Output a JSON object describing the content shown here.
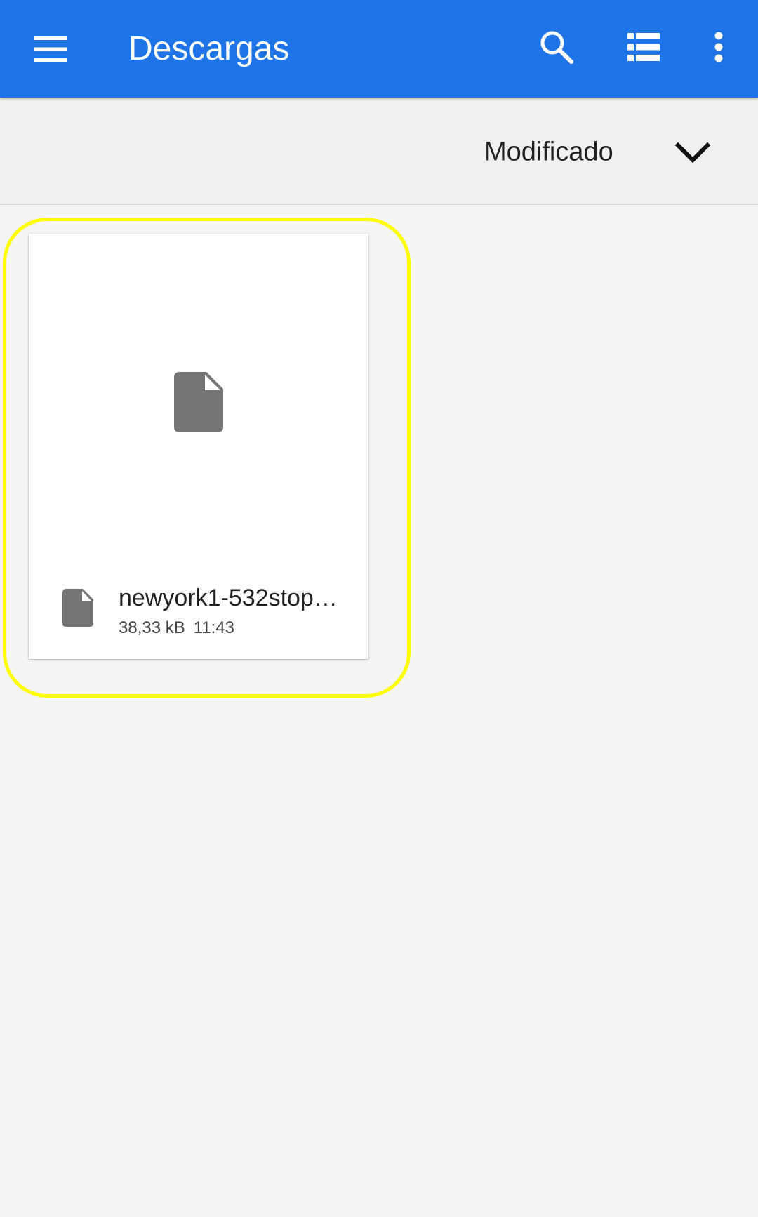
{
  "appbar": {
    "title": "Descargas",
    "menu_icon": "hamburger-menu-icon",
    "search_icon": "search-icon",
    "view_icon": "list-view-icon",
    "more_icon": "more-vert-icon",
    "color": "#1e74e6"
  },
  "sort": {
    "label": "Modificado",
    "chevron_icon": "chevron-down-icon"
  },
  "files": [
    {
      "name": "newyork1-532stop…",
      "size": "38,33 kB",
      "time": "11:43",
      "icon": "file-icon"
    }
  ],
  "highlight_color": "#ffff00"
}
